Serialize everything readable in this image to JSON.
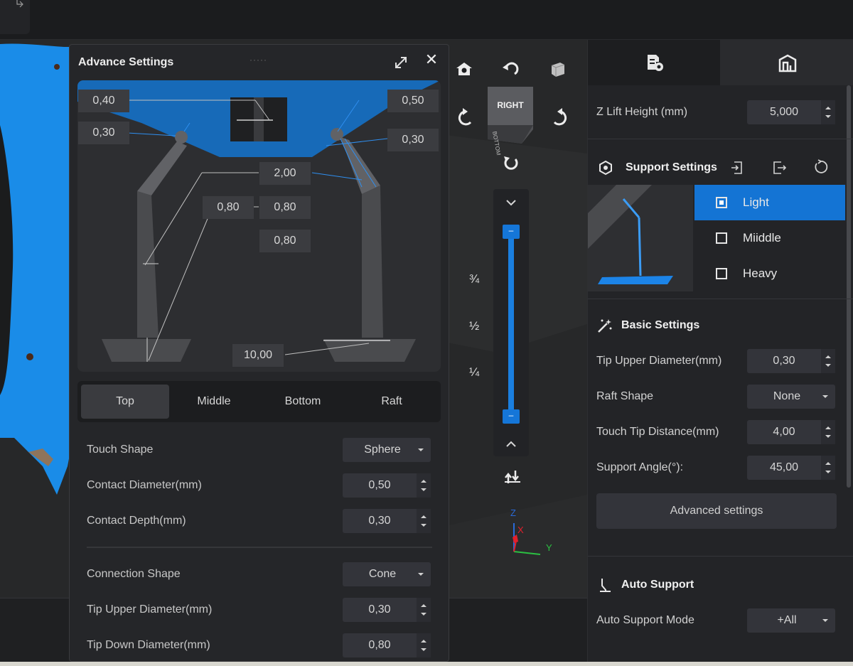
{
  "adv_panel": {
    "title": "Advance Settings",
    "grip": "·····",
    "diagram_values": {
      "tip_left": "0,40",
      "contact_left": "0,30",
      "tip_right": "0,50",
      "contact_right": "0,30",
      "mid1": "2,00",
      "mid2a": "0,80",
      "mid2b": "0,80",
      "mid3": "0,80",
      "base": "10,00"
    },
    "tabs": [
      "Top",
      "Middle",
      "Bottom",
      "Raft"
    ],
    "active_tab": "Top",
    "rows": {
      "touch_shape": {
        "label": "Touch Shape",
        "value": "Sphere"
      },
      "contact_diameter": {
        "label": "Contact Diameter(mm)",
        "value": "0,50"
      },
      "contact_depth": {
        "label": "Contact Depth(mm)",
        "value": "0,30"
      },
      "connection_shape": {
        "label": "Connection Shape",
        "value": "Cone"
      },
      "tip_upper": {
        "label": "Tip Upper Diameter(mm)",
        "value": "0,30"
      },
      "tip_down": {
        "label": "Tip Down Diameter(mm)",
        "value": "0,80"
      }
    }
  },
  "view_tools": {
    "cube_label": "RIGHT",
    "cube_side_label": "BOTTOM",
    "fractions": [
      "¾",
      "½",
      "¼"
    ],
    "slider_knob_top": "–",
    "slider_knob_bottom": "–",
    "axes": {
      "z": "Z",
      "x": "X",
      "y": "Y"
    }
  },
  "right_panel": {
    "z_lift": {
      "label": "Z Lift Height (mm)",
      "value": "5,000"
    },
    "support_settings": {
      "title": "Support Settings",
      "presets": [
        {
          "label": "Light",
          "active": true
        },
        {
          "label": "Miiddle",
          "active": false
        },
        {
          "label": "Heavy",
          "active": false
        }
      ]
    },
    "basic_settings": {
      "title": "Basic Settings",
      "tip_upper": {
        "label": "Tip Upper Diameter(mm)",
        "value": "0,30"
      },
      "raft_shape": {
        "label": "Raft Shape",
        "value": "None"
      },
      "touch_tip": {
        "label": "Touch Tip Distance(mm)",
        "value": "4,00"
      },
      "support_angle": {
        "label": "Support Angle(°):",
        "value": "45,00"
      },
      "advanced_button": "Advanced settings"
    },
    "auto_support": {
      "title": "Auto Support",
      "mode": {
        "label": "Auto Support Mode",
        "value": "+All"
      }
    }
  },
  "colors": {
    "accent": "#1474d4",
    "model_blue": "#1a8ce8",
    "panel_bg": "#252629"
  }
}
